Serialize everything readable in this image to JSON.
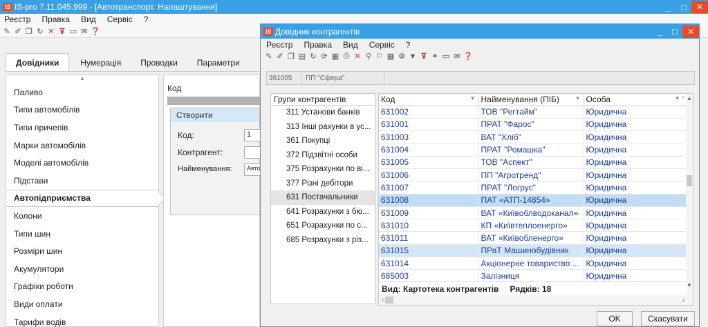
{
  "main_window": {
    "logo": "IS",
    "title": "IS-pro 7.11.045.999 - [Автотранспорт. Налаштування]",
    "menu": [
      "Реєстр",
      "Правка",
      "Вид",
      "Сервіс",
      "?"
    ],
    "tabs": [
      "Довідники",
      "Нумерація",
      "Проводки",
      "Параметри"
    ],
    "left_items": [
      "Паливо",
      "Типи автомобілів",
      "Типи причепів",
      "Марки автомобілів",
      "Моделі автомобілів",
      "Підстави",
      "Автопідприємства",
      "Колони",
      "Типи шин",
      "Розміри шин",
      "Акумулятори",
      "Графіки роботи",
      "Види оплати",
      "Тарифи водів"
    ],
    "selected_left_item": "Автопідприємства",
    "middle_header": "Код",
    "create_dialog": {
      "title": "Створити",
      "code_label": "Код:",
      "code_value": "1",
      "counterparty_label": "Контрагент:",
      "counterparty_value": "",
      "name_label": "Найменування:",
      "name_value": "Авто"
    }
  },
  "child_window": {
    "logo": "IS",
    "title": "Довідник контрагентів",
    "menu": [
      "Реєстр",
      "Правка",
      "Вид",
      "Сервіс",
      "?"
    ],
    "code_field": {
      "code": "361005",
      "name": "ПП \"Сфера\""
    },
    "groups_header": "Групи контрагентів",
    "groups": [
      "311 Установи банків",
      "313 Інші рахунки в ус...",
      "361 Покупці",
      "372 Підзвітні особи",
      "375 Розрахунки по ві...",
      "377 Різні дебітори",
      "631 Постачальники",
      "641 Розрахунки з бю...",
      "651 Розрахунки по с...",
      "685 Розрахунки з різ..."
    ],
    "selected_group": "631 Постачальники",
    "columns": [
      "Код",
      "Найменування (ПІБ)",
      "Особа"
    ],
    "rows": [
      {
        "code": "631002",
        "name": "ТОВ \"Регтайм\"",
        "person": "Юридична"
      },
      {
        "code": "631001",
        "name": "ПРАТ \"Фарос\"",
        "person": "Юридична"
      },
      {
        "code": "631003",
        "name": "ВАТ \"Хліб\"",
        "person": "Юридична"
      },
      {
        "code": "631004",
        "name": "ПРАТ \"Ромашка\"",
        "person": "Юридична"
      },
      {
        "code": "631005",
        "name": "ТОВ \"Аспект\"",
        "person": "Юридична"
      },
      {
        "code": "631006",
        "name": "ПП \"Агротренд\"",
        "person": "Юридична"
      },
      {
        "code": "631007",
        "name": "ПРАТ \"Логрус\"",
        "person": "Юридична"
      },
      {
        "code": "631008",
        "name": "ПАТ «АТП-14854»",
        "person": "Юридична"
      },
      {
        "code": "631009",
        "name": "ВАТ «Київоблводоканал»",
        "person": "Юридична"
      },
      {
        "code": "631010",
        "name": "КП «Київтеплоенерго»",
        "person": "Юридична"
      },
      {
        "code": "631011",
        "name": "ВАТ «Київобленерго»",
        "person": "Юридична"
      },
      {
        "code": "631015",
        "name": "ПРаТ Машинобудівник",
        "person": "Юридична"
      },
      {
        "code": "631014",
        "name": "Акціонерне товариство ...",
        "person": "Юридична"
      },
      {
        "code": "685003",
        "name": "Залізниця",
        "person": "Юридична"
      }
    ],
    "focused_row": "631008",
    "highlighted_row": "631015",
    "status_view": "Вид: Картотека контрагентів",
    "status_rows": "Рядків: 18",
    "ok_label": "OK",
    "cancel_label": "Скасувати"
  }
}
